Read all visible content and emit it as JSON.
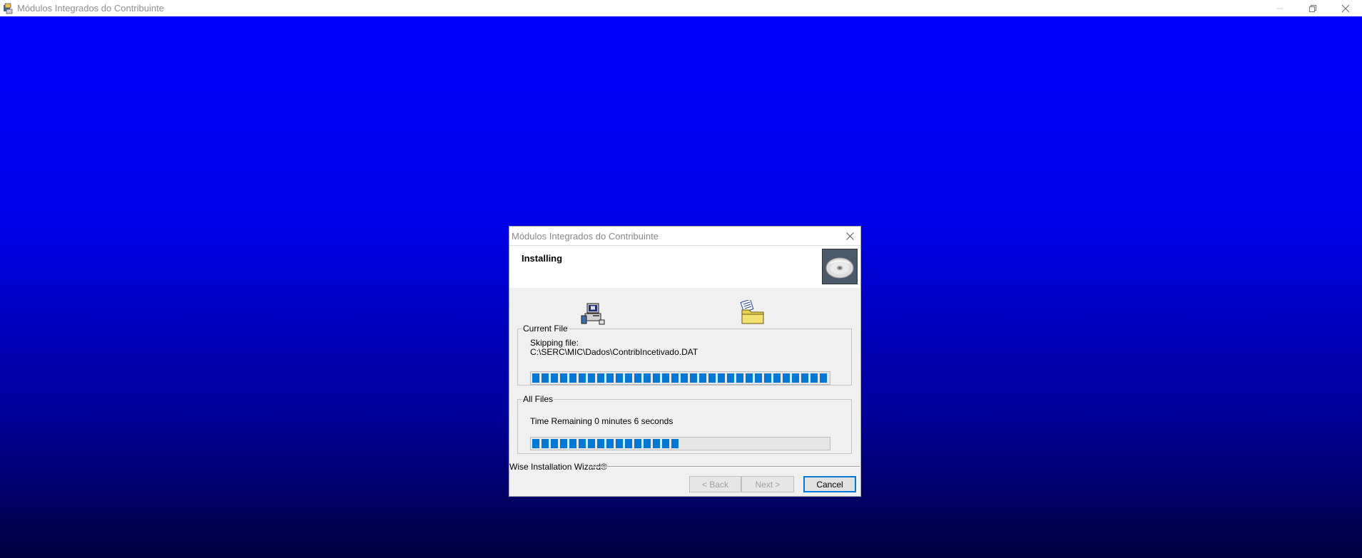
{
  "window": {
    "title": "Módulos Integrados do Contribuinte"
  },
  "dialog": {
    "title": "Módulos Integrados do Contribuinte",
    "heading": "Installing",
    "current_file": {
      "legend": "Current File",
      "status": "Skipping file:",
      "path": "C:\\SERC\\MIC\\Dados\\ContribIncetivado.DAT",
      "progress": 1.0
    },
    "all_files": {
      "legend": "All Files",
      "time_remaining": "Time Remaining 0 minutes 6 seconds",
      "progress": 0.5
    },
    "brand": "Wise Installation Wizard®",
    "buttons": {
      "back": "< Back",
      "next": "Next >",
      "cancel": "Cancel"
    }
  },
  "colors": {
    "progress_fill": "#0078d7",
    "desktop_top": "#0000ff",
    "desktop_bottom": "#00003e"
  },
  "icons": [
    "app-icon",
    "minimize-icon",
    "restore-icon",
    "close-icon",
    "cd-disc-icon",
    "computer-icon",
    "folder-files-icon"
  ]
}
